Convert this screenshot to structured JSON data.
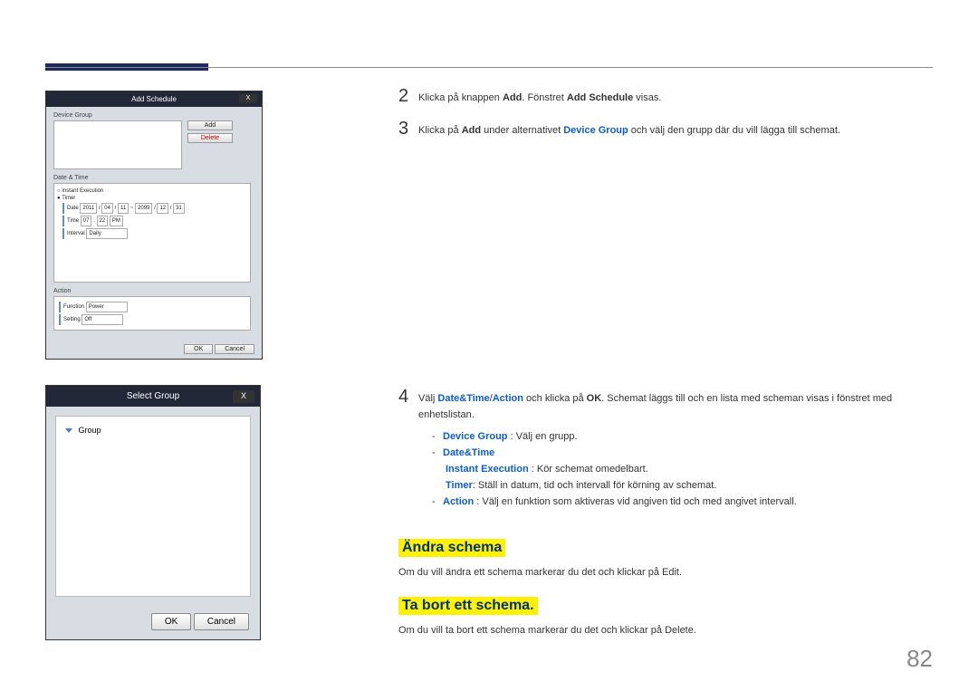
{
  "pageNumber": "82",
  "shot1": {
    "windowTitle": "Add Schedule",
    "close": "X",
    "devGroupLabel": "Device Group",
    "addBtn": "Add",
    "deleteBtn": "Delete",
    "dateTimeLabel": "Date & Time",
    "instantExec": "Instant Execution",
    "timer": "Timer",
    "dateLabel": "Date",
    "dateY1": "2011",
    "dateM1": "04",
    "dateD1": "11",
    "dateY2": "2099",
    "dateM2": "12",
    "dateD2": "31",
    "timeLabel": "Time",
    "timeH": "07",
    "timeM": "22",
    "timeAP": "PM",
    "intervalLabel": "Interval",
    "intervalVal": "Daily",
    "actionLabel": "Action",
    "functionLabel": "Function",
    "functionVal": "Power",
    "settingLabel": "Setting",
    "settingVal": "Off",
    "ok": "OK",
    "cancel": "Cancel"
  },
  "shot2": {
    "title": "Select Group",
    "close": "X",
    "item": "Group",
    "ok": "OK",
    "cancel": "Cancel"
  },
  "step2": {
    "num": "2",
    "t1": "Klicka på knappen ",
    "b1": "Add",
    "t2": ". Fönstret ",
    "b2": "Add Schedule",
    "t3": " visas."
  },
  "step3": {
    "num": "3",
    "t1": "Klicka på ",
    "b1": "Add",
    "t2": " under alternativet ",
    "b2": "Device Group",
    "t3": " och välj den grupp där du vill lägga till schemat."
  },
  "step4": {
    "num": "4",
    "t1": "Välj ",
    "b1": "Date&Time",
    "t2": "/",
    "b2": "Action",
    "t3": " och klicka på ",
    "b3": "OK",
    "t4": ". Schemat läggs till och en lista med scheman visas i fönstret med enhetslistan.",
    "sub1a": "Device Group",
    "sub1b": " : Välj en grupp.",
    "sub2": "Date&Time",
    "sub2a": "Instant Execution",
    "sub2b": " : Kör schemat omedelbart.",
    "sub2c": "Timer",
    "sub2d": ": Ställ in datum, tid och intervall för körning av schemat.",
    "sub3a": "Action",
    "sub3b": " : Välj en funktion som aktiveras vid angiven tid och med angivet intervall."
  },
  "heading1": "Ändra schema",
  "para1a": "Om du vill ändra ett schema markerar du det och klickar på ",
  "para1b": "Edit",
  "para1c": ".",
  "heading2": "Ta bort ett schema.",
  "para2a": "Om du vill ta bort ett schema markerar du det och klickar på ",
  "para2b": "Delete",
  "para2c": "."
}
